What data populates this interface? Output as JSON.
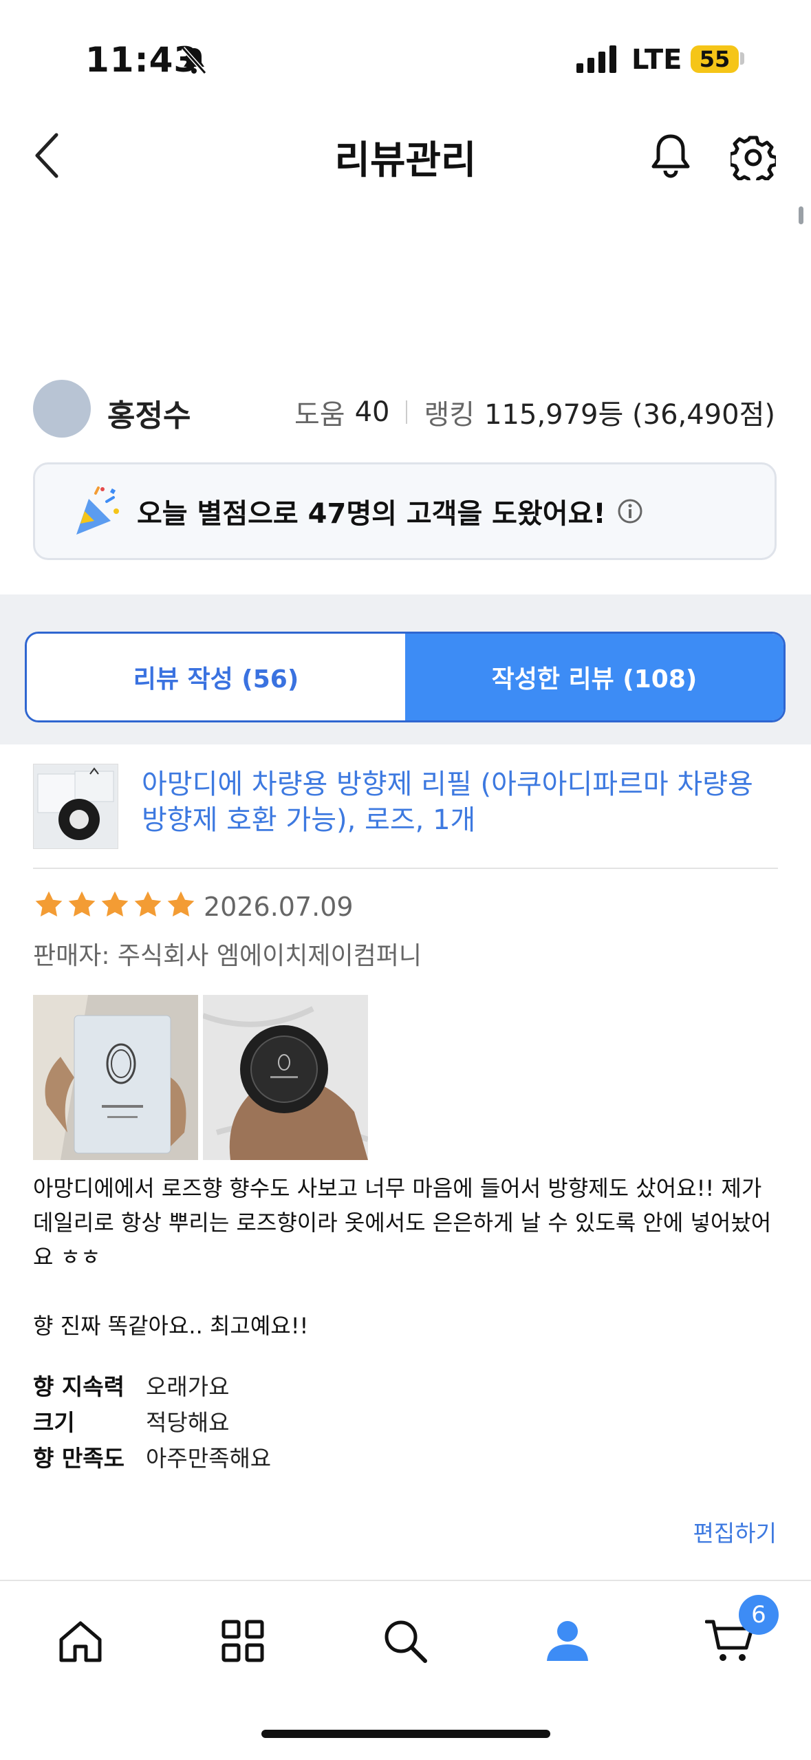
{
  "status_bar": {
    "time": "11:43",
    "network": "LTE",
    "battery": "55"
  },
  "header": {
    "title": "리뷰관리"
  },
  "profile": {
    "name": "홍정수",
    "help_label": "도움",
    "help_value": "40",
    "rank_label": "랭킹",
    "rank_value": "115,979등 (36,490점)"
  },
  "banner": {
    "text": "오늘 별점으로 47명의 고객을 도왔어요!"
  },
  "tabs": [
    {
      "label": "리뷰 작성 (56)",
      "active": false
    },
    {
      "label": "작성한 리뷰 (108)",
      "active": true
    }
  ],
  "review": {
    "product_title": "아망디에 차량용 방향제 리필 (아쿠아디파르마 차량용 방향제 호환 가능), 로즈, 1개",
    "rating": 5,
    "date": "2026.07.09",
    "seller": "판매자: 주식회사 엠에이치제이컴퍼니",
    "body": "아망디에에서 로즈향 향수도 사보고 너무 마음에 들어서 방향제도 샀어요!! 제가 데일리로 항상 뿌리는 로즈향이라 옷에서도 은은하게 날 수 있도록 안에 넣어놨어요 ㅎㅎ\n\n향 진짜 똑같아요.. 최고예요!!",
    "attributes": [
      {
        "key": "향 지속력",
        "value": "오래가요"
      },
      {
        "key": "크기",
        "value": "적당해요"
      },
      {
        "key": "향 만족도",
        "value": "아주만족해요"
      }
    ],
    "edit_label": "편집하기"
  },
  "bottom_nav": {
    "cart_count": "6"
  },
  "colors": {
    "accent": "#3d8cf5",
    "link": "#3d79e0",
    "star": "#f39c34"
  }
}
